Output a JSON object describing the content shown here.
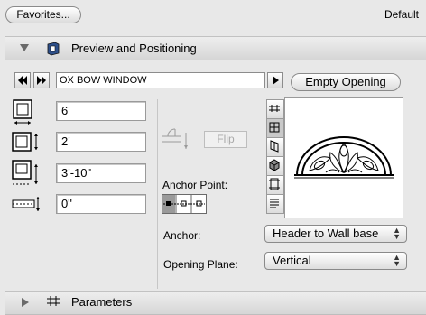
{
  "toolbar": {
    "favorites_label": "Favorites...",
    "default_label": "Default"
  },
  "section_preview": {
    "title": "Preview and Positioning",
    "expanded": true
  },
  "section_parameters": {
    "title": "Parameters",
    "expanded": false
  },
  "object": {
    "name": "OX BOW WINDOW"
  },
  "empty_opening_label": "Empty Opening",
  "dimensions": {
    "width": "6'",
    "height": "2'",
    "sill_height": "3'-10\"",
    "wall_offset": "0\""
  },
  "flip_label": "Flip",
  "anchor_point_label": "Anchor Point:",
  "anchor": {
    "label": "Anchor:",
    "value": "Header to Wall base"
  },
  "opening_plane": {
    "label": "Opening Plane:",
    "value": "Vertical"
  },
  "icons": {
    "prev": "double-left-arrow-icon",
    "next": "double-right-arrow-icon",
    "play": "play-icon"
  }
}
